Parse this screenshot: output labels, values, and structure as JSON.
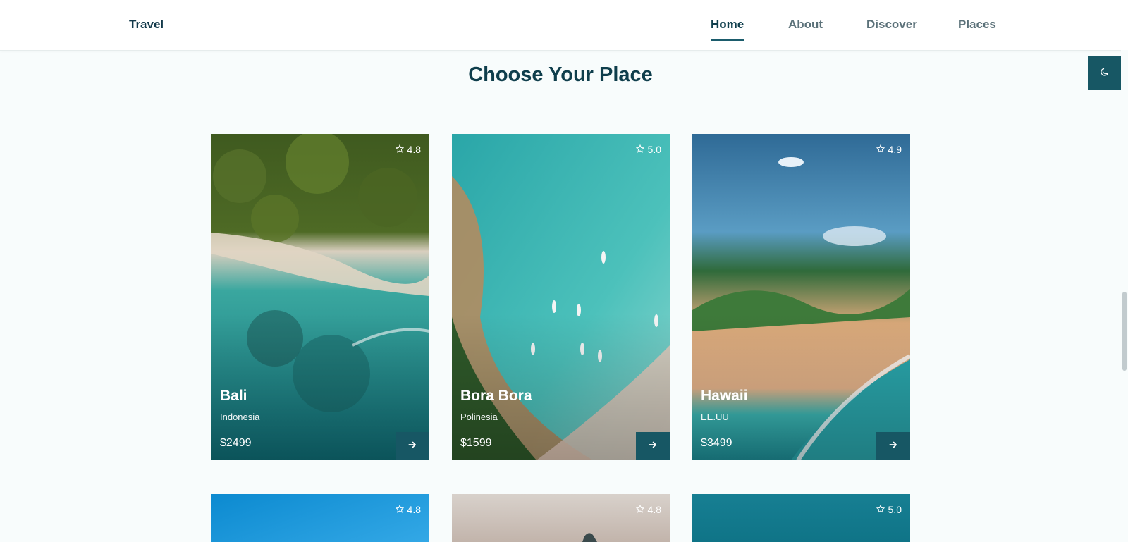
{
  "header": {
    "logo": "Travel",
    "nav": [
      {
        "label": "Home",
        "active": true
      },
      {
        "label": "About",
        "active": false
      },
      {
        "label": "Discover",
        "active": false
      },
      {
        "label": "Places",
        "active": false
      }
    ]
  },
  "theme_toggle": {
    "icon": "moon-icon"
  },
  "section": {
    "title": "Choose Your Place"
  },
  "cards": [
    {
      "rating": "4.8",
      "name": "Bali",
      "location": "Indonesia",
      "price": "$2499"
    },
    {
      "rating": "5.0",
      "name": "Bora Bora",
      "location": "Polinesia",
      "price": "$1599"
    },
    {
      "rating": "4.9",
      "name": "Hawaii",
      "location": "EE.UU",
      "price": "$3499"
    },
    {
      "rating": "4.8"
    },
    {
      "rating": "4.8"
    },
    {
      "rating": "5.0"
    }
  ],
  "colors": {
    "accent": "#175764",
    "title": "#0f3e4c",
    "background": "#f8fcfc"
  }
}
